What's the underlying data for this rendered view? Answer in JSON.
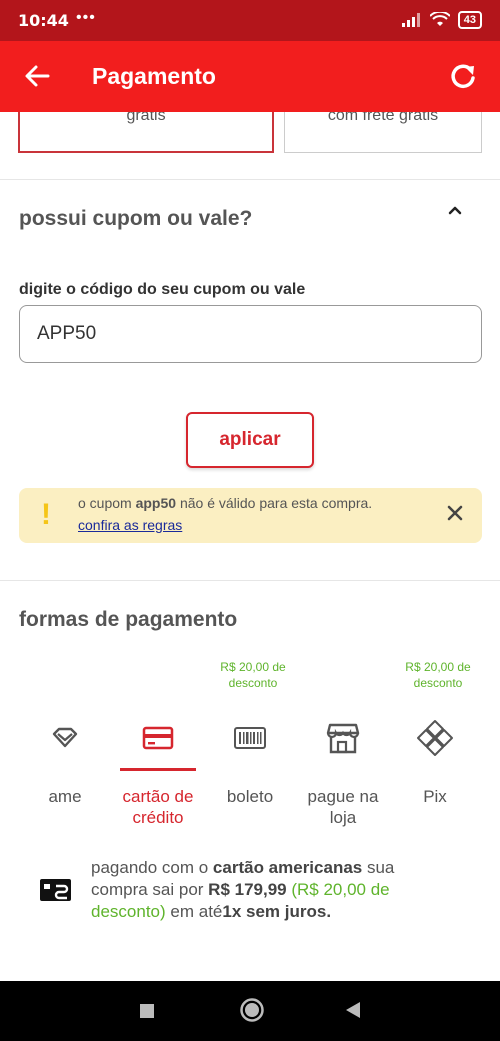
{
  "status_bar": {
    "time": "10:44",
    "dots": "•••",
    "battery": "43"
  },
  "app_bar": {
    "title": "Pagamento"
  },
  "shipping_options": [
    {
      "label": "grátis"
    },
    {
      "label": "com frete grátis"
    }
  ],
  "coupon": {
    "title": "possui cupom ou vale?",
    "field_label": "digite o código do seu cupom ou vale",
    "value": "APP50",
    "apply_label": "aplicar",
    "alert": {
      "prefix": "o cupom ",
      "code": "app50",
      "suffix": " não é válido para esta compra.",
      "link": "confira as regras"
    }
  },
  "payment": {
    "title": "formas de pagamento",
    "methods": [
      {
        "label": "ame",
        "icon": "ame-icon",
        "discount": ""
      },
      {
        "label": "cartão de crédito",
        "icon": "credit-card-icon",
        "discount": "",
        "selected": true
      },
      {
        "label": "boleto",
        "icon": "barcode-icon",
        "discount": "R$ 20,00 de desconto"
      },
      {
        "label": "pague na loja",
        "icon": "store-icon",
        "discount": ""
      },
      {
        "label": "Pix",
        "icon": "pix-icon",
        "discount": "R$ 20,00 de desconto"
      }
    ],
    "info": {
      "t1": "pagando com o ",
      "b1": "cartão americanas",
      "t2": " sua compra sai por ",
      "b2": "R$ 179,99",
      "g1": " (R$ 20,00 de desconto)",
      "t3": " em até",
      "b3": "1x sem juros."
    }
  },
  "colors": {
    "status_bar": "#b3151b",
    "app_bar": "#f21e1e",
    "accent": "#d6262e",
    "discount_green": "#5fb42c",
    "alert_bg": "#fbefc2"
  }
}
